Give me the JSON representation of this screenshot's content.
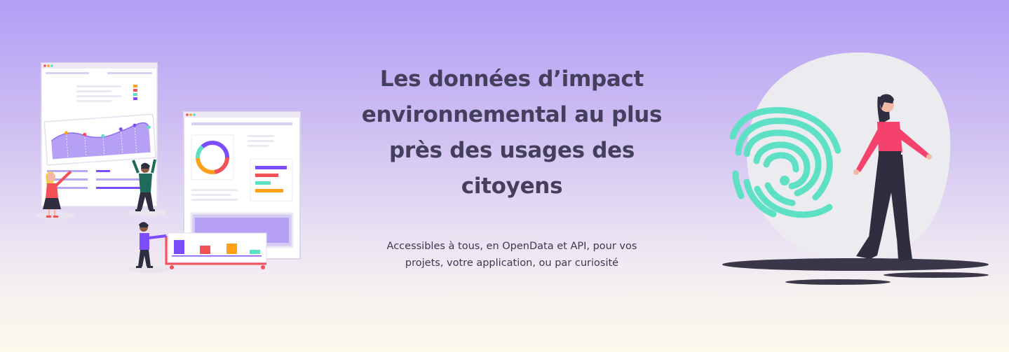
{
  "hero": {
    "headline": "Les données d’impact environnemental au plus près des usages des citoyens",
    "subtitle": "Accessibles à tous, en OpenData et API, pour vos projets, votre application, ou par curiosité"
  },
  "illustrations": {
    "left": "team-dashboard-illustration",
    "right": "woman-fingerprint-illustration"
  },
  "colors": {
    "headline": "#433f5c",
    "accent_purple": "#7c4dff",
    "accent_teal": "#5ee0c4",
    "accent_red": "#f25157",
    "accent_orange": "#ff9f1a",
    "accent_pink": "#f5426c"
  }
}
